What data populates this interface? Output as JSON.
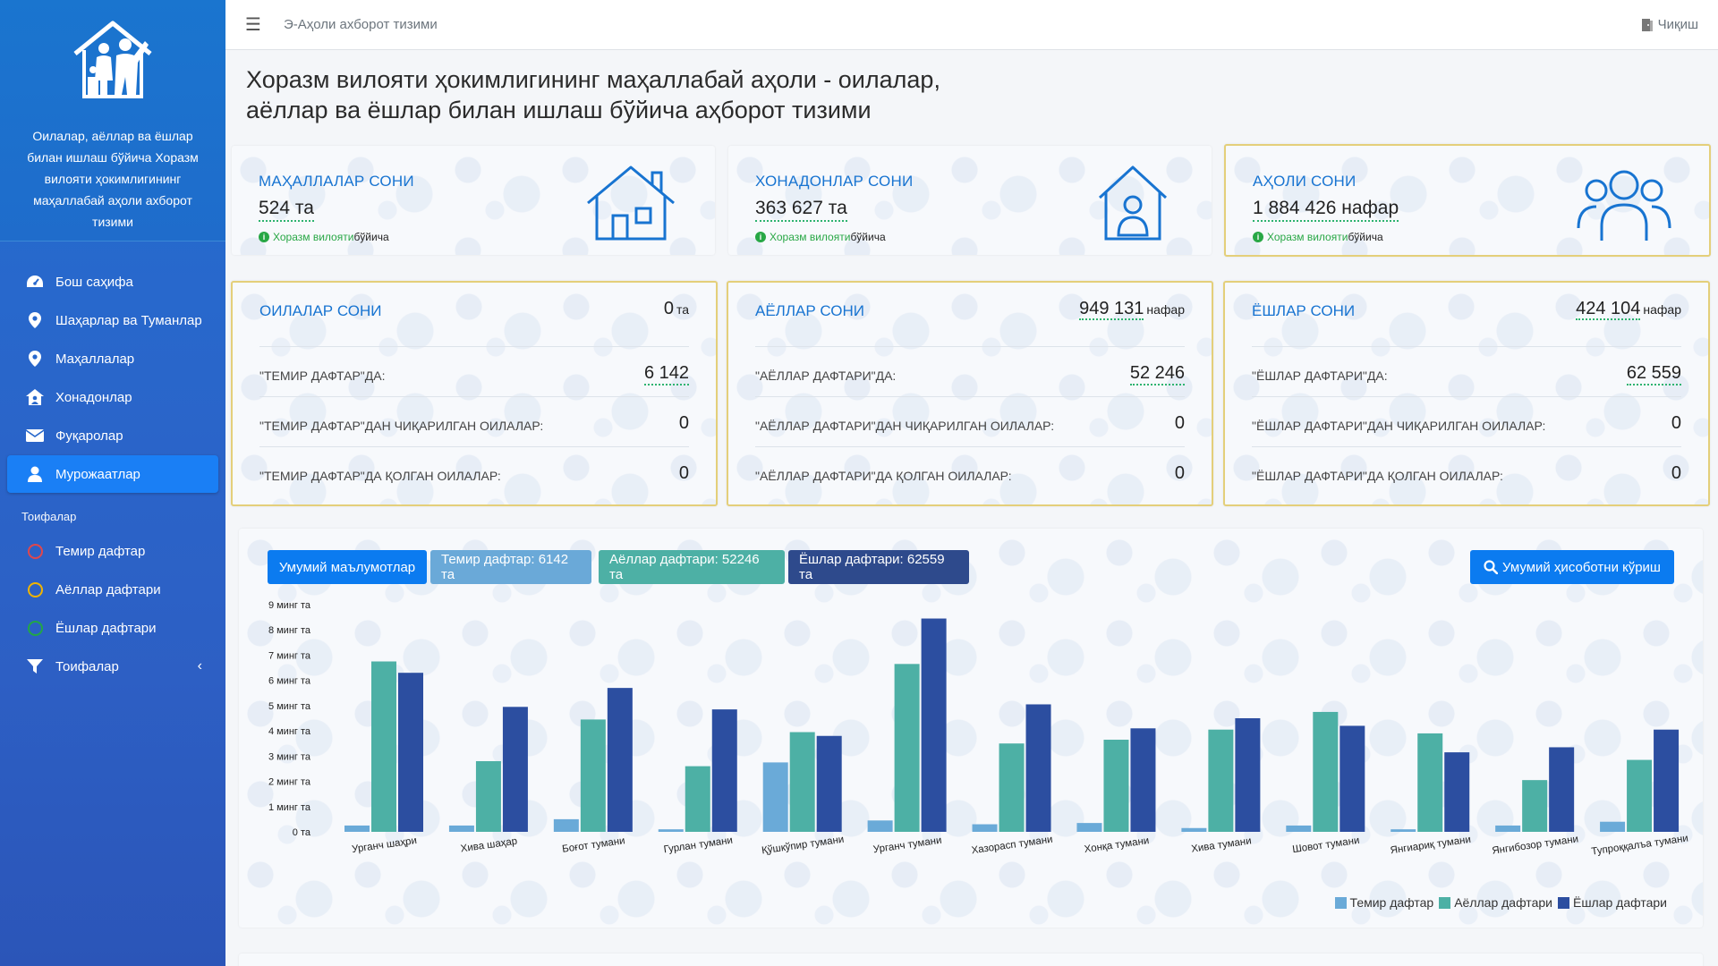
{
  "sidebar": {
    "brand_text": "Оилалар, аёллар ва ёшлар билан ишлаш бўйича Хоразм вилояти ҳокимлигининг маҳаллабай аҳоли ахборот тизими",
    "items": [
      {
        "label": "Бош саҳифа",
        "icon": "dashboard-icon"
      },
      {
        "label": "Шаҳарлар ва Туманлар",
        "icon": "map-marker-icon"
      },
      {
        "label": "Маҳаллалар",
        "icon": "map-marker-icon"
      },
      {
        "label": "Хонадонлар",
        "icon": "house-user-icon"
      },
      {
        "label": "Фуқаролар",
        "icon": "envelope-icon"
      },
      {
        "label": "Мурожаатлар",
        "icon": "user-icon"
      }
    ],
    "section_header": "Тоифалар",
    "category_items": [
      {
        "label": "Темир дафтар",
        "color": "#e0474c"
      },
      {
        "label": "Аёллар дафтари",
        "color": "#f0b400"
      },
      {
        "label": "Ёшлар дафтари",
        "color": "#22a647"
      }
    ],
    "filter_item": {
      "label": "Тоифалар"
    }
  },
  "topbar": {
    "title": "Э-Аҳоли ахборот тизими",
    "logout_label": "Чиқиш"
  },
  "page": {
    "title_line1": "Хоразм вилояти ҳокимлигининг маҳаллабай аҳоли - оилалар,",
    "title_line2": "аёллар ва ёшлар билан ишлаш бўйича аҳборот тизими"
  },
  "stats": [
    {
      "label": "МАҲАЛЛАЛАР СОНИ",
      "value": "524 та",
      "note_green": "Хоразм вилояти",
      "note_rest": " бўйича"
    },
    {
      "label": "ХОНАДОНЛАР СОНИ",
      "value": "363 627 та",
      "note_green": "Хоразм вилояти",
      "note_rest": " бўйича"
    },
    {
      "label": "АҲОЛИ СОНИ",
      "value": "1 884 426 нафар",
      "note_green": "Хоразм вилояти",
      "note_rest": " бўйича"
    }
  ],
  "families": {
    "title": "ОИЛАЛАР СОНИ",
    "total": "0",
    "unit": "та",
    "rows": [
      {
        "label": "\"ТЕМИР ДАФТАР\"ДА:",
        "value": "6 142"
      },
      {
        "label": "\"ТЕМИР ДАФТАР\"ДАН ЧИҚАРИЛГАН ОИЛАЛАР:",
        "value": "0"
      },
      {
        "label": "\"ТЕМИР ДАФТАР\"ДА ҚОЛГАН ОИЛАЛАР:",
        "value": "0"
      }
    ]
  },
  "women": {
    "title": "АЁЛЛАР СОНИ",
    "total": "949 131",
    "unit": "нафар",
    "rows": [
      {
        "label": "\"АЁЛЛАР ДАФТАРИ\"ДА:",
        "value": "52 246"
      },
      {
        "label": "\"АЁЛЛАР ДАФТАРИ\"ДАН ЧИҚАРИЛГАН ОИЛАЛАР:",
        "value": "0"
      },
      {
        "label": "\"АЁЛЛАР ДАФТАРИ\"ДА ҚОЛГАН ОИЛАЛАР:",
        "value": "0"
      }
    ]
  },
  "youth": {
    "title": "ЁШЛАР СОНИ",
    "total": "424 104",
    "unit": "нафар",
    "rows": [
      {
        "label": "\"ЁШЛАР ДАФТАРИ\"ДА:",
        "value": "62 559"
      },
      {
        "label": "\"ЁШЛАР ДАФТАРИ\"ДАН ЧИҚАРИЛГАН ОИЛАЛАР:",
        "value": "0"
      },
      {
        "label": "\"ЁШЛАР ДАФТАРИ\"ДА ҚОЛГАН ОИЛАЛАР:",
        "value": "0"
      }
    ]
  },
  "chart_buttons": {
    "general": "Умумий маълумотлар",
    "iron": "Темир дафтар: 6142 та",
    "women": "Аёллар дафтари: 52246 та",
    "youth": "Ёшлар дафтари: 62559 та",
    "report": "Умумий ҳисоботни кўриш"
  },
  "chart_data": {
    "type": "bar",
    "categories": [
      "Урганч шаҳри",
      "Хива шаҳар",
      "Боғот тумани",
      "Гурлан тумани",
      "Қўшкўпир тумани",
      "Урганч тумани",
      "Хазорасп тумани",
      "Хонқа тумани",
      "Хива тумани",
      "Шовот тумани",
      "Янгиариқ тумани",
      "Янгибозор тумани",
      "Тупроққалъа тумани"
    ],
    "series": [
      {
        "name": "Темир дафтар",
        "color": "#6aaad8",
        "values": [
          250,
          250,
          500,
          100,
          2750,
          450,
          300,
          350,
          150,
          250,
          100,
          250,
          400
        ]
      },
      {
        "name": "Аёллар дафтари",
        "color": "#4db0a5",
        "values": [
          6750,
          2800,
          4450,
          2600,
          3950,
          6650,
          3500,
          3650,
          4050,
          4750,
          3900,
          2050,
          2850
        ]
      },
      {
        "name": "Ёшлар дафтари",
        "color": "#2c4ea0",
        "values": [
          6300,
          4950,
          5700,
          4850,
          3800,
          8450,
          5050,
          4100,
          4500,
          4200,
          3150,
          3350,
          4050
        ]
      }
    ],
    "yticks": [
      "0 та",
      "1 минг та",
      "2 минг та",
      "3 минг та",
      "4 минг та",
      "5 минг та",
      "6 минг та",
      "7 минг та",
      "8 минг та",
      "9 минг та"
    ],
    "ylim": [
      0,
      9000
    ],
    "legend_position": "bottom-right"
  }
}
